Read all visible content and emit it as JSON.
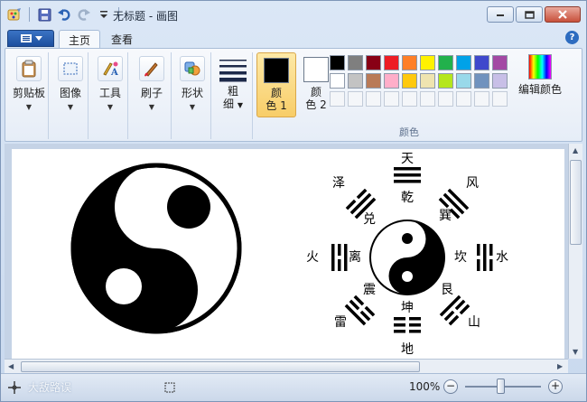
{
  "window": {
    "title": "无标题 - 画图"
  },
  "tabs": {
    "home": "主页",
    "view": "查看"
  },
  "ribbon": {
    "clipboard": "剪贴板",
    "image": "图像",
    "tools": "工具",
    "brushes": "刷子",
    "shapes": "形状",
    "size_line1": "粗",
    "size_line2": "细",
    "color1_line1": "颜",
    "color1_line2": "色 1",
    "color2_line1": "颜",
    "color2_line2": "色 2",
    "colors_group": "颜色",
    "edit_colors": "编辑颜色",
    "palette": [
      "#000000",
      "#7f7f7f",
      "#880015",
      "#ed1c24",
      "#ff7f27",
      "#fff200",
      "#22b14c",
      "#00a2e8",
      "#3f48cc",
      "#a349a4",
      "#ffffff",
      "#c3c3c3",
      "#b97a57",
      "#ffaec9",
      "#ffc90e",
      "#efe4b0",
      "#b5e61d",
      "#99d9ea",
      "#7092be",
      "#c8bfe7"
    ],
    "color1": "#000000",
    "color2": "#ffffff"
  },
  "bagua": {
    "top_outer": "天",
    "top_inner": "乾",
    "topright_outer": "风",
    "topright_inner": "巽",
    "right_outer": "水",
    "right_inner": "坎",
    "bottomright_outer": "山",
    "bottomright_inner": "艮",
    "bottom_outer": "地",
    "bottom_inner": "坤",
    "bottomleft_outer": "雷",
    "bottomleft_inner": "震",
    "left_outer": "火",
    "left_inner": "离",
    "topleft_outer": "泽",
    "topleft_inner": "兑"
  },
  "status": {
    "zoom": "100%",
    "zoom_out": "−",
    "zoom_in": "+",
    "watermark": "大敌路误"
  }
}
